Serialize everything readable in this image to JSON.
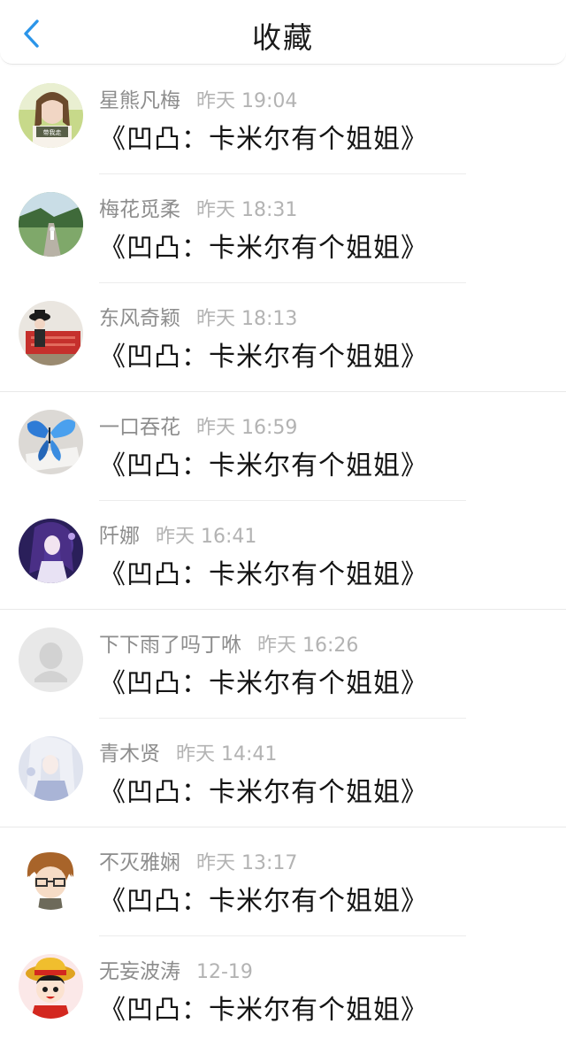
{
  "header": {
    "title": "收藏",
    "back_icon": "chevron-left-icon",
    "accent": "#2b95e9"
  },
  "items": [
    {
      "name": "星熊凡梅",
      "time": "昨天 19:04",
      "message": "《凹凸：卡米尔有个姐姐》",
      "avatar_caption": "带我走"
    },
    {
      "name": "梅花觅柔",
      "time": "昨天 18:31",
      "message": "《凹凸：卡米尔有个姐姐》"
    },
    {
      "name": "东风奇颖",
      "time": "昨天 18:13",
      "message": "《凹凸：卡米尔有个姐姐》"
    },
    {
      "name": "一口吞花",
      "time": "昨天 16:59",
      "message": "《凹凸：卡米尔有个姐姐》"
    },
    {
      "name": "阡娜",
      "time": "昨天 16:41",
      "message": "《凹凸：卡米尔有个姐姐》"
    },
    {
      "name": "下下雨了吗丁咻",
      "time": "昨天 16:26",
      "message": "《凹凸：卡米尔有个姐姐》"
    },
    {
      "name": "青木贤",
      "time": "昨天 14:41",
      "message": "《凹凸：卡米尔有个姐姐》"
    },
    {
      "name": "不灭雅娴",
      "time": "昨天 13:17",
      "message": "《凹凸：卡米尔有个姐姐》"
    },
    {
      "name": "无妄波涛",
      "time": "12-19",
      "message": "《凹凸：卡米尔有个姐姐》"
    }
  ]
}
